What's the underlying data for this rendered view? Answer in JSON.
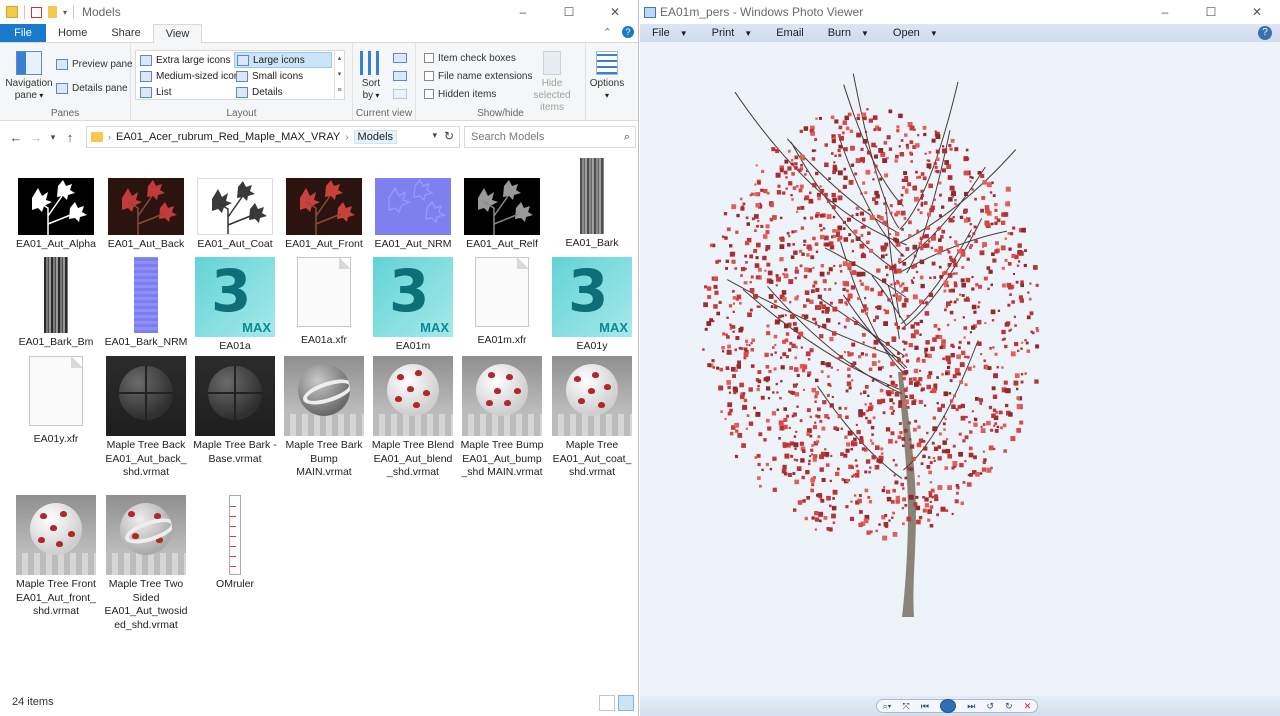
{
  "explorer": {
    "title": "Models",
    "window_controls": [
      "–",
      "☐",
      "✕"
    ],
    "tabs": [
      {
        "label": "File"
      },
      {
        "label": "Home"
      },
      {
        "label": "Share"
      },
      {
        "label": "View"
      }
    ],
    "ribbon": {
      "panes": {
        "group_label": "Panes",
        "navigation_pane": "Navigation pane",
        "preview_pane": "Preview pane",
        "details_pane": "Details pane"
      },
      "layout": {
        "group_label": "Layout",
        "items": [
          "Extra large icons",
          "Large icons",
          "Medium-sized icons",
          "Small icons",
          "List",
          "Details"
        ],
        "selected": "Large icons"
      },
      "current_view": {
        "group_label": "Current view",
        "sort_by": "Sort by"
      },
      "show_hide": {
        "group_label": "Show/hide",
        "item_check_boxes": "Item check boxes",
        "file_name_extensions": "File name extensions",
        "hidden_items": "Hidden items",
        "hide_selected_items": "Hide selected items"
      },
      "options": "Options"
    },
    "address": {
      "crumbs": [
        "EA01_Acer_rubrum_Red_Maple_MAX_VRAY",
        "Models"
      ],
      "search_placeholder": "Search Models"
    },
    "files": [
      {
        "name": "EA01_Aut_Alpha"
      },
      {
        "name": "EA01_Aut_Back"
      },
      {
        "name": "EA01_Aut_Coat"
      },
      {
        "name": "EA01_Aut_Front"
      },
      {
        "name": "EA01_Aut_NRM"
      },
      {
        "name": "EA01_Aut_Relf"
      },
      {
        "name": "EA01_Bark"
      },
      {
        "name": "EA01_Bark_Bm"
      },
      {
        "name": "EA01_Bark_NRM"
      },
      {
        "name": "EA01a"
      },
      {
        "name": "EA01a.xfr"
      },
      {
        "name": "EA01m"
      },
      {
        "name": "EA01m.xfr"
      },
      {
        "name": "EA01y"
      },
      {
        "name": "EA01y.xfr"
      },
      {
        "name": "Maple Tree Back EA01_Aut_back_shd.vrmat"
      },
      {
        "name": "Maple Tree Bark - Base.vrmat"
      },
      {
        "name": "Maple Tree Bark Bump MAIN.vrmat"
      },
      {
        "name": "Maple Tree Blend EA01_Aut_blend_shd.vrmat"
      },
      {
        "name": "Maple Tree Bump EA01_Aut_bump_shd MAIN.vrmat"
      },
      {
        "name": "Maple Tree EA01_Aut_coat_shd.vrmat"
      },
      {
        "name": "Maple Tree Front EA01_Aut_front_shd.vrmat"
      },
      {
        "name": "Maple Tree Two Sided EA01_Aut_twosided_shd.vrmat"
      },
      {
        "name": "OMruler"
      }
    ],
    "status": "24 items",
    "colors": {
      "accent": "#1979ca",
      "selection": "#cce4f7"
    }
  },
  "viewer": {
    "title": "EA01m_pers - Windows Photo Viewer",
    "window_controls": [
      "–",
      "☐",
      "✕"
    ],
    "menu": [
      "File",
      "Print",
      "Email",
      "Burn",
      "Open"
    ],
    "colors": {
      "background": "#eef3fa",
      "foliage": "#c23a3a",
      "trunk": "#8a8378"
    }
  }
}
